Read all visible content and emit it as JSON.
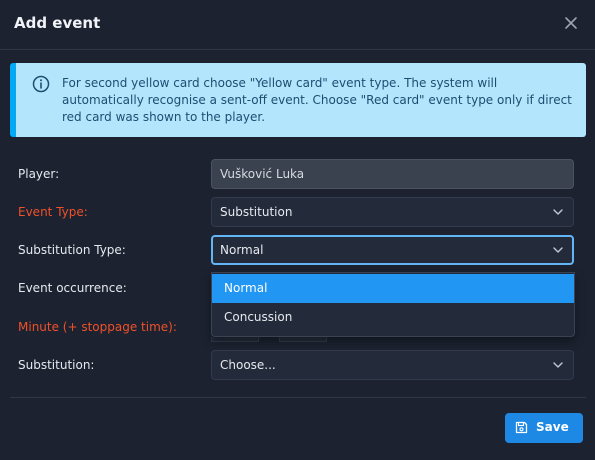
{
  "dialog": {
    "title": "Add event",
    "close_icon": "close-icon"
  },
  "info": {
    "icon": "info-icon",
    "text": "For second yellow card choose \"Yellow card\" event type. The system will automatically recognise a sent-off event. Choose \"Red card\" event type only if direct red card was shown to the player."
  },
  "form": {
    "player": {
      "label": "Player:",
      "value": "Vušković Luka"
    },
    "event_type": {
      "label": "Event Type:",
      "value": "Substitution"
    },
    "substitution_type": {
      "label": "Substitution Type:",
      "value": "Normal",
      "options": [
        "Normal",
        "Concussion"
      ]
    },
    "event_occurrence": {
      "label": "Event occurrence:"
    },
    "minute": {
      "label": "Minute (+ stoppage time):"
    },
    "substitution": {
      "label": "Substitution:",
      "value": "Choose..."
    }
  },
  "footer": {
    "save_label": "Save",
    "save_icon": "save-icon"
  },
  "colors": {
    "accent": "#1e88e5",
    "required_label": "#f0502a",
    "info_bg": "#b3e5fc",
    "selected_option": "#2196f3"
  }
}
